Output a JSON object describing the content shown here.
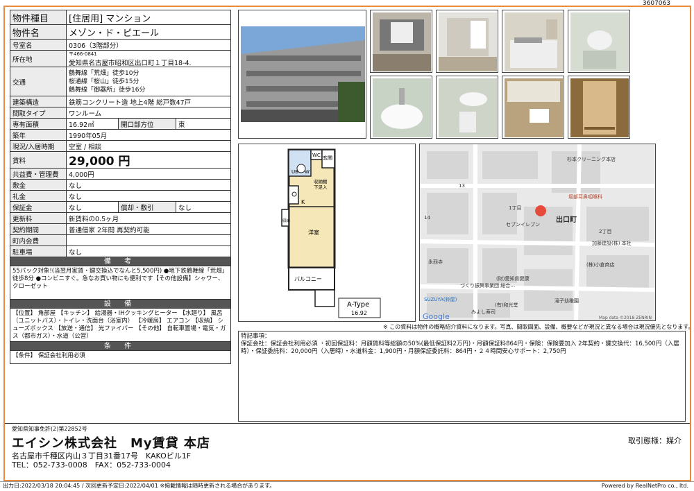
{
  "doc_id": "3607063",
  "spec": {
    "type_label": "物件種目",
    "type_value": "[住居用] マンション",
    "name_label": "物件名",
    "name_value": "メゾン・ド・ピエール",
    "room_label": "号室名",
    "room_value": "0306（3階部分）",
    "addr_label": "所在地",
    "addr_zip": "〒466-0841",
    "addr_value": "愛知県名古屋市昭和区出口町１丁目18-4.",
    "transit_label": "交通",
    "transit": [
      "鶴舞線「荒畑」徒歩10分",
      "桜通線「桜山」徒歩15分",
      "鶴舞線「御器所」徒歩16分"
    ],
    "struct_label": "建築構造",
    "struct_value": "鉄筋コンクリート造 地上4階 総戸数47戸",
    "layout_label": "間取タイプ",
    "layout_value": "ワンルーム",
    "area_label": "専有面積",
    "area_value": "16.92㎡",
    "dir_label": "開口部方位",
    "dir_value": "東",
    "built_label": "築年",
    "built_value": "1990年05月",
    "status_label": "現況/入居時期",
    "status_value": "空室 / 相談",
    "rent_label": "賃料",
    "rent_value": "29,000 円",
    "fee_label": "共益費・管理費",
    "fee_value": "4,000円",
    "deposit_label": "敷金",
    "deposit_value": "なし",
    "key_label": "礼金",
    "key_value": "なし",
    "hold_label": "保証金",
    "hold_value": "なし",
    "amort_label": "償却・敷引",
    "amort_value": "なし",
    "renew_label": "更新料",
    "renew_value": "新賃料の0.5ヶ月",
    "contract_label": "契約期間",
    "contract_value": "普通借家 2年間 再契約可能",
    "assoc_label": "町内会費",
    "assoc_value": "",
    "parking_label": "駐車場",
    "parking_value": "なし"
  },
  "remarks": {
    "head": "備 考",
    "text": "55パック対象!(当翌月家賃・鍵交換込でなんと5,500円) ●地下鉄鶴舞線「荒畑」徒歩8分 ●コンビニすぐ。急なお買い物にも便利です【その他設備】シャワー、クローゼット"
  },
  "facilities": {
    "head": "設 備",
    "text": "【位置】 角部屋 【キッチン】 給湯器・IHクッキングヒーター 【水廻り】 風呂（ユニットバス）・トイレ・洗面台（浴室内） 【冷暖房】 エアコン 【収納】 シューズボックス 【放送・通信】 光ファイバー 【その他】 自転車置場・電気・ガス（都市ガス）・水道（公営）"
  },
  "conditions": {
    "head": "条 件",
    "text": "【条件】 保証会社利用必須"
  },
  "plan": {
    "labels": {
      "wc": "WC",
      "ub": "UB",
      "wm": "W",
      "entrance": "玄関",
      "shoebox": "下足入",
      "storage": "収納棚",
      "k": "K",
      "room": "洋室",
      "closet": "収納",
      "balcony": "バルコニー"
    },
    "type": "A-Type",
    "area": "16.92"
  },
  "map": {
    "labels": [
      "杉本クリーニング本店",
      "堀部耳鼻咽喉科",
      "1丁目",
      "出口町",
      "セブンイレブン",
      "2丁目",
      "加藤建設(株) 本社",
      "永西寺",
      "(株)小倉商店",
      "(財)愛知県健康",
      "づくり振興事業団 総合…",
      "SUZUYA(鈴屋)",
      "(有)和光堂",
      "みよし寿司",
      "滝子幼稚園",
      "13",
      "14"
    ],
    "google": "Google",
    "credit": "Map data ©2018 ZENRIN"
  },
  "disclaimer": "※ この資料は物件の概略紹介資料になります。写真、間取図面、設備、概要などが現況と異なる場合は現況優先となります。",
  "notes": {
    "title": "特記事項：",
    "text": "保証会社：保証会社利用必須 ・初回保証料：月額賃料等総額の50%(最低保証料2万円)・月額保証料864円・保険：保険要加入 2年契約・鍵交換代：16,500円（入居時）・保証委託料：20,000円（入居時）・水道料金：1,900円・月額保証委託料：864円・２４時間安心サポート：2,750円"
  },
  "footer": {
    "license": "愛知県知事免許(2)第22852号",
    "company": "エイシン株式会社　My賃貸 本店",
    "address": "名古屋市千種区内山３丁目31番17号　KAKOビル1F",
    "tel": "TEL：052-733-0008　FAX：052-733-0004",
    "torihiki": "取引態様：媒介"
  },
  "bottom": {
    "left": "出力日:2022/03/18 20:04:45 / 次回更新予定日:2022/04/01 ※掲載情報は随時更新される場合があります。",
    "right": "Powered by RealNetPro co., ltd."
  }
}
